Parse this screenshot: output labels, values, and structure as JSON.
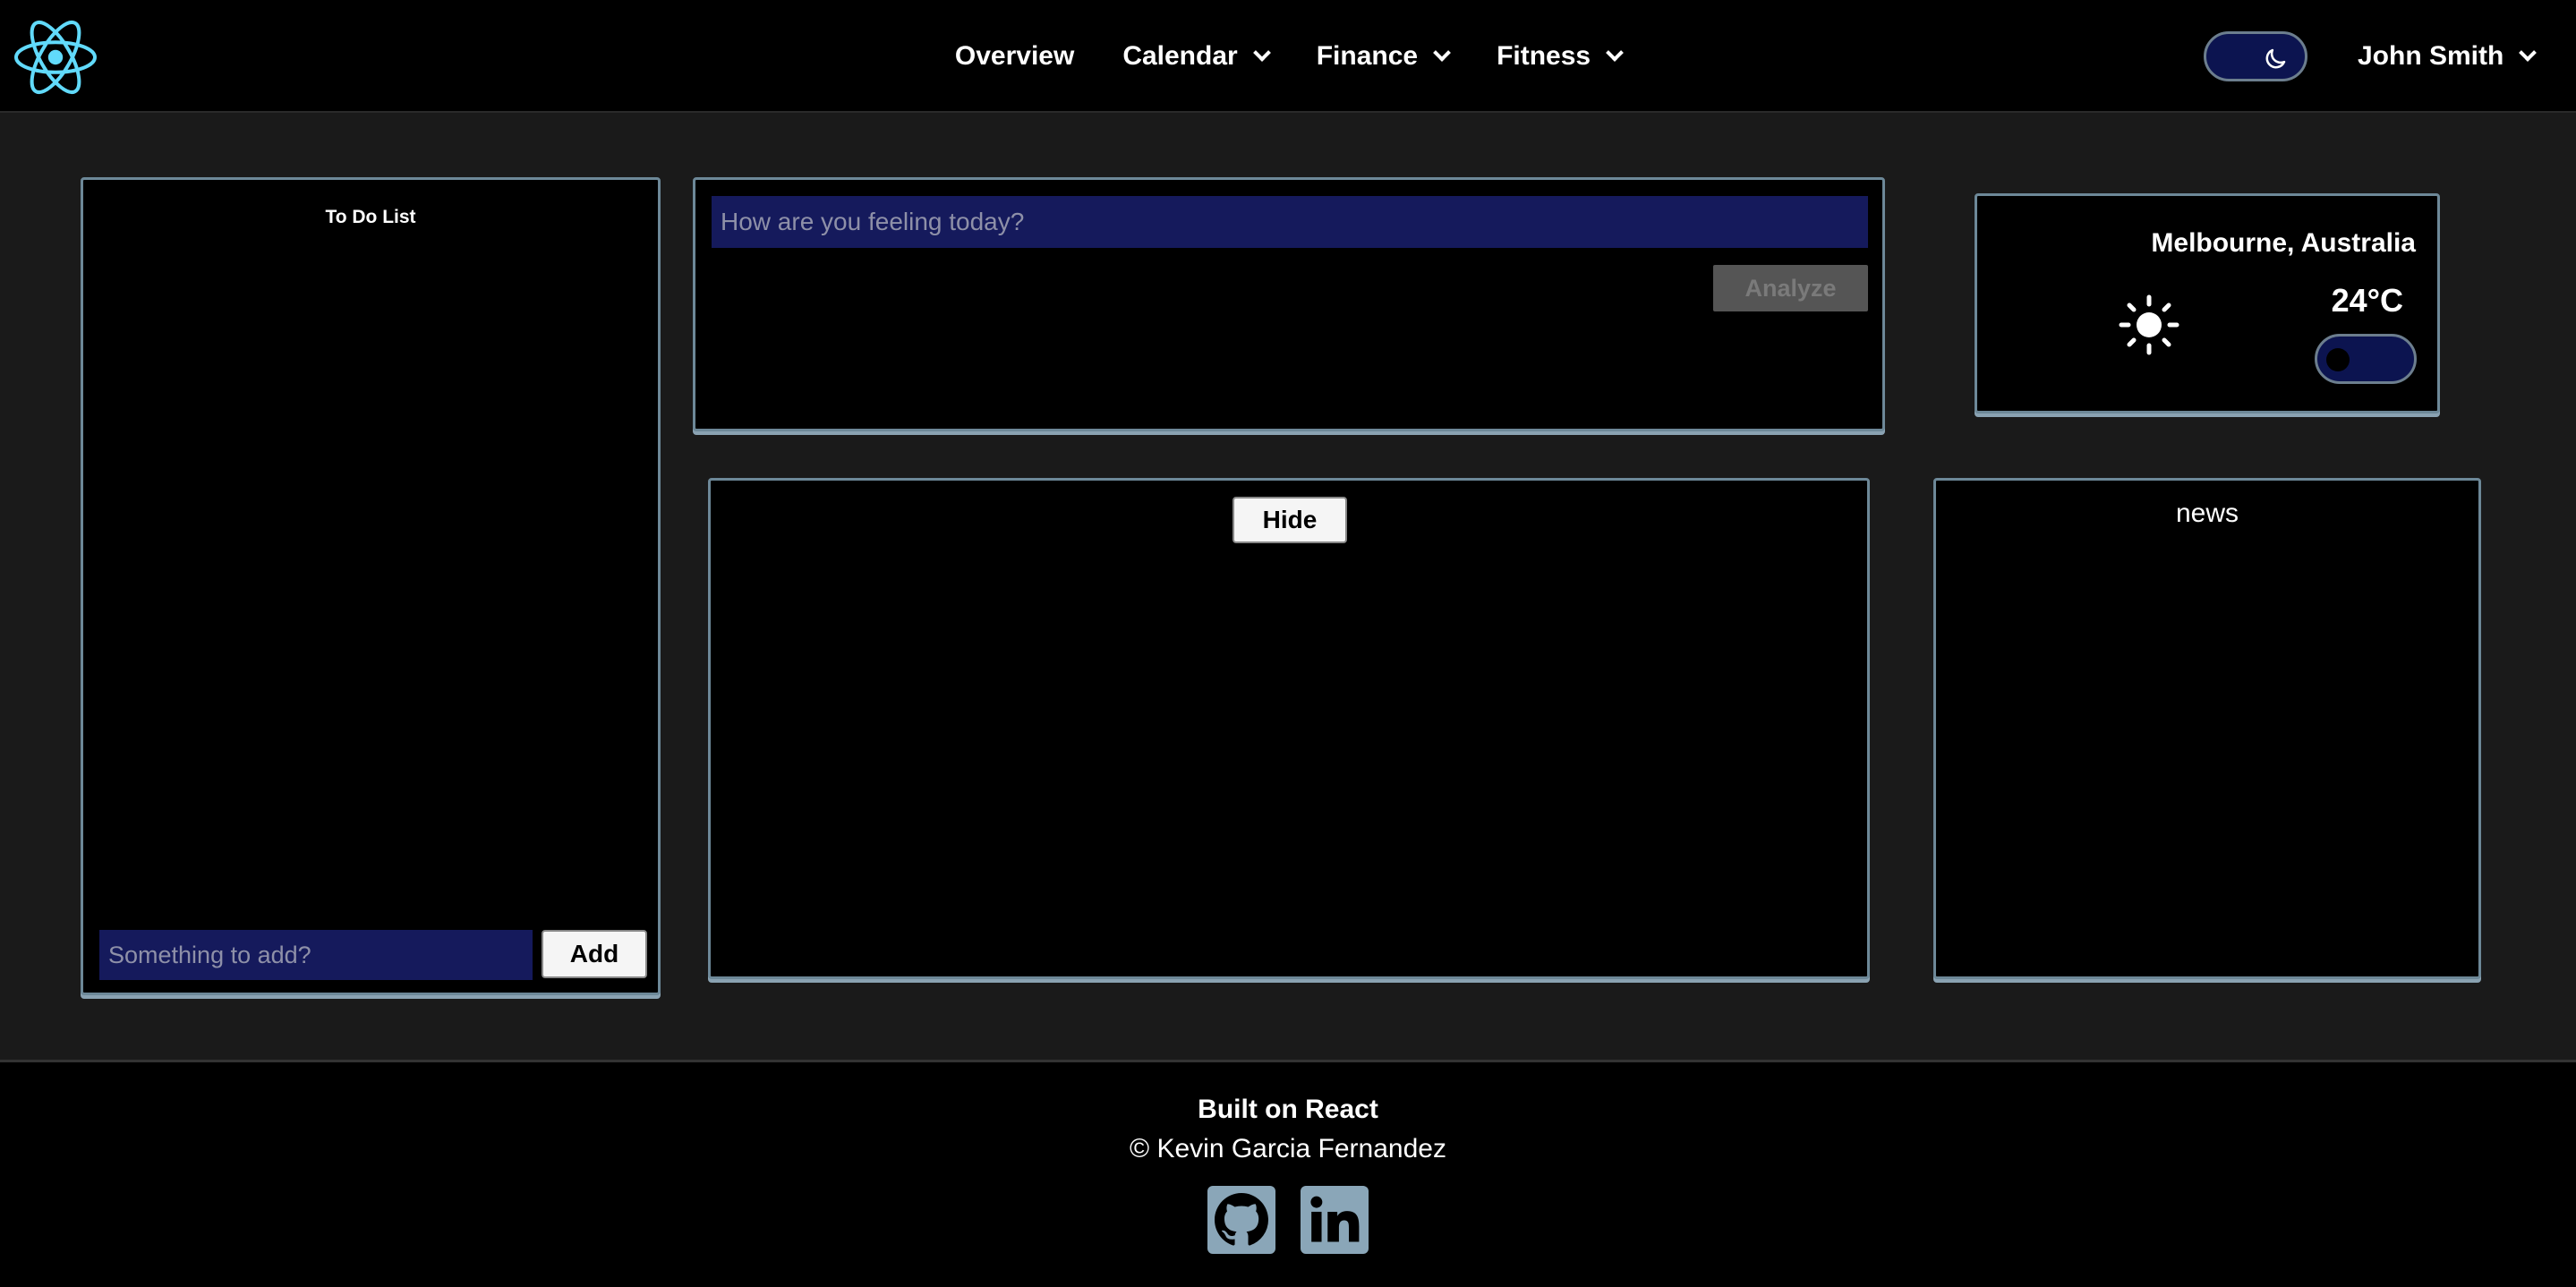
{
  "nav": {
    "logo_icon": "react-logo-icon",
    "links": [
      {
        "label": "Overview",
        "has_dropdown": false
      },
      {
        "label": "Calendar",
        "has_dropdown": true
      },
      {
        "label": "Finance",
        "has_dropdown": true
      },
      {
        "label": "Fitness",
        "has_dropdown": true
      }
    ],
    "theme_toggle_icon": "moon-icon",
    "user_name": "John Smith"
  },
  "todo": {
    "title": "To Do List",
    "input_placeholder": "Something to add?",
    "add_label": "Add"
  },
  "mood": {
    "input_placeholder": "How are you feeling today?",
    "analyze_label": "Analyze"
  },
  "weather": {
    "city": "Melbourne, Australia",
    "temperature": "24°C",
    "condition_icon": "sun-icon"
  },
  "center_panel": {
    "hide_label": "Hide"
  },
  "news": {
    "title": "news"
  },
  "footer": {
    "title": "Built on React",
    "credit": "© Kevin Garcia Fernandez",
    "social_icons": [
      "github-icon",
      "linkedin-icon"
    ]
  },
  "colors": {
    "background": "#1a1a1a",
    "panel": "#000000",
    "card_border": "#6d8898",
    "input_bg": "#151a5c",
    "react_blue": "#61dafb",
    "toggle_bg": "#0c1450",
    "social_bg": "#8aa6b8"
  }
}
